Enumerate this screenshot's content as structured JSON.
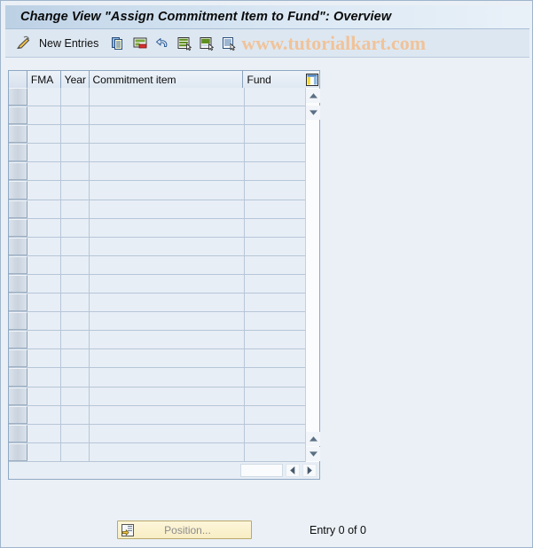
{
  "window": {
    "title": "Change View \"Assign Commitment Item to Fund\": Overview"
  },
  "toolbar": {
    "check_icon": "pencil-check-icon",
    "new_entries_label": "New Entries",
    "icons": [
      {
        "name": "copy-icon",
        "tooltip": "Copy As..."
      },
      {
        "name": "delete-icon",
        "tooltip": "Delete"
      },
      {
        "name": "undo-icon",
        "tooltip": "Undo Change"
      },
      {
        "name": "select-all-icon",
        "tooltip": "Select All"
      },
      {
        "name": "deselect-all-icon",
        "tooltip": "Deselect All"
      },
      {
        "name": "details-icon",
        "tooltip": "Details"
      }
    ],
    "watermark": "www.tutorialkart.com"
  },
  "grid": {
    "columns": [
      {
        "key": "selector",
        "label": ""
      },
      {
        "key": "fma",
        "label": "FMA"
      },
      {
        "key": "year",
        "label": "Year"
      },
      {
        "key": "ci",
        "label": "Commitment item"
      },
      {
        "key": "fund",
        "label": "Fund"
      }
    ],
    "config_icon": "column-config-icon",
    "row_count": 20,
    "rows": [],
    "scroll": {
      "up_icon": "scroll-up-icon",
      "down_icon": "scroll-down-icon",
      "left_icon": "scroll-left-icon",
      "right_icon": "scroll-right-icon"
    }
  },
  "footer": {
    "position_button": {
      "label": "Position...",
      "icon": "position-icon"
    },
    "entry_status": "Entry 0 of 0"
  },
  "colors": {
    "window_bg": "#eaf0f6",
    "title_bar_start": "#bcd0e4",
    "title_bar_end": "#e9f1f8",
    "toolbar_bg": "#dde7f1",
    "grid_cell_bg": "#e8eef6",
    "grid_border": "#8fa9c4",
    "watermark": "#f0c39a",
    "button_yellow": "#f8edc4"
  }
}
